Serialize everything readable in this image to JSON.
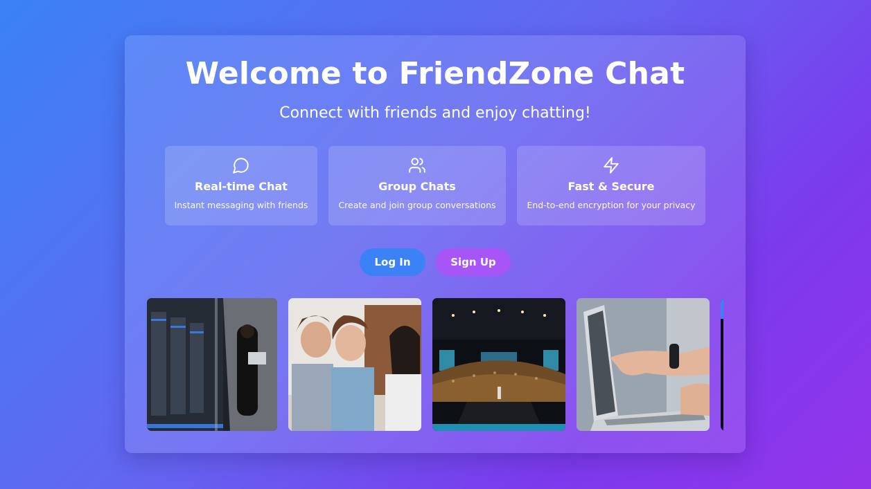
{
  "hero": {
    "title": "Welcome to FriendZone Chat",
    "subtitle": "Connect with friends and enjoy chatting!"
  },
  "features": [
    {
      "icon": "chat-bubble-icon",
      "title": "Real-time Chat",
      "description": "Instant messaging with friends"
    },
    {
      "icon": "users-icon",
      "title": "Group Chats",
      "description": "Create and join group conversations"
    },
    {
      "icon": "lightning-icon",
      "title": "Fast & Secure",
      "description": "End-to-end encryption for your privacy"
    }
  ],
  "actions": {
    "login_label": "Log In",
    "signup_label": "Sign Up"
  },
  "gallery": {
    "images": [
      "server-room-photo",
      "friends-laughing-photo",
      "conference-audience-photo",
      "laptop-pointing-photo",
      "partial-photo"
    ]
  },
  "colors": {
    "login": "#3b82f6",
    "signup": "#a855f7"
  }
}
